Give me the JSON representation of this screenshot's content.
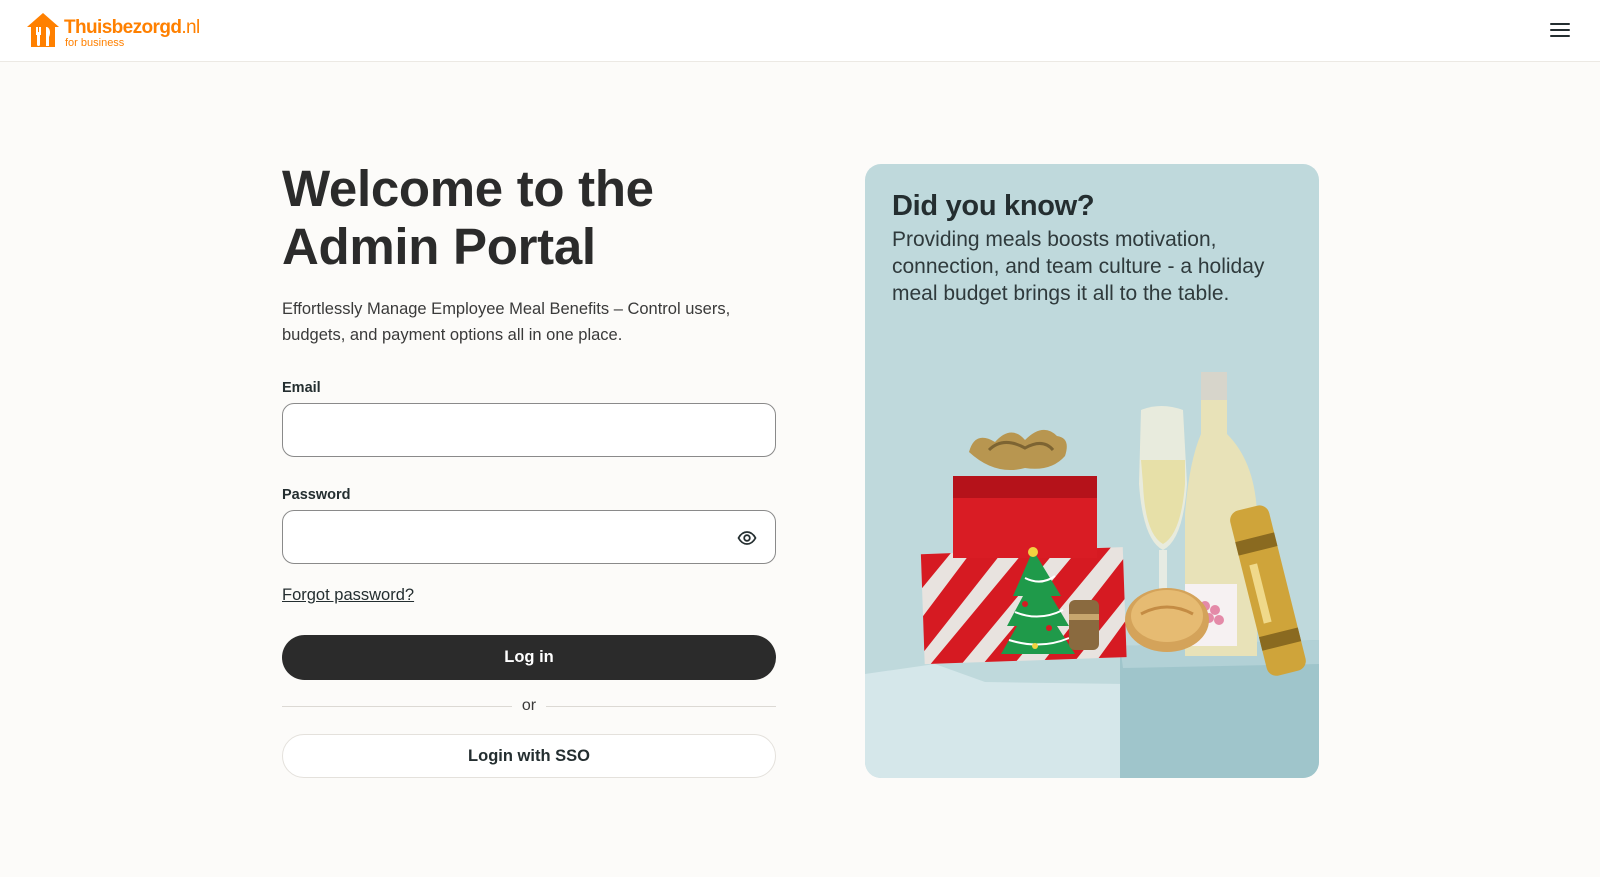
{
  "header": {
    "brand_name": "Thuisbezorgd",
    "brand_tld": ".nl",
    "brand_tagline": "for business",
    "menu_icon": "hamburger-menu-icon"
  },
  "login": {
    "title_line1": "Welcome to the",
    "title_line2": "Admin Portal",
    "subtitle": "Effortlessly Manage Employee Meal Benefits – Control users, budgets, and payment options all in one place.",
    "email_label": "Email",
    "email_value": "",
    "password_label": "Password",
    "password_value": "",
    "password_toggle_icon": "eye-icon",
    "forgot_password": "Forgot password?",
    "login_button": "Log in",
    "divider_text": "or",
    "sso_button": "Login with SSO"
  },
  "promo": {
    "title": "Did you know?",
    "text": "Providing meals boosts motivation, connection, and team culture - a holiday meal budget brings it all to the table.",
    "illustration": "holiday-gifts-and-champagne-image"
  },
  "colors": {
    "brand_orange": "#ff8000",
    "button_dark": "#2b2b2b",
    "card_background": "#bfd9dc",
    "page_background": "#fcfbf9"
  }
}
